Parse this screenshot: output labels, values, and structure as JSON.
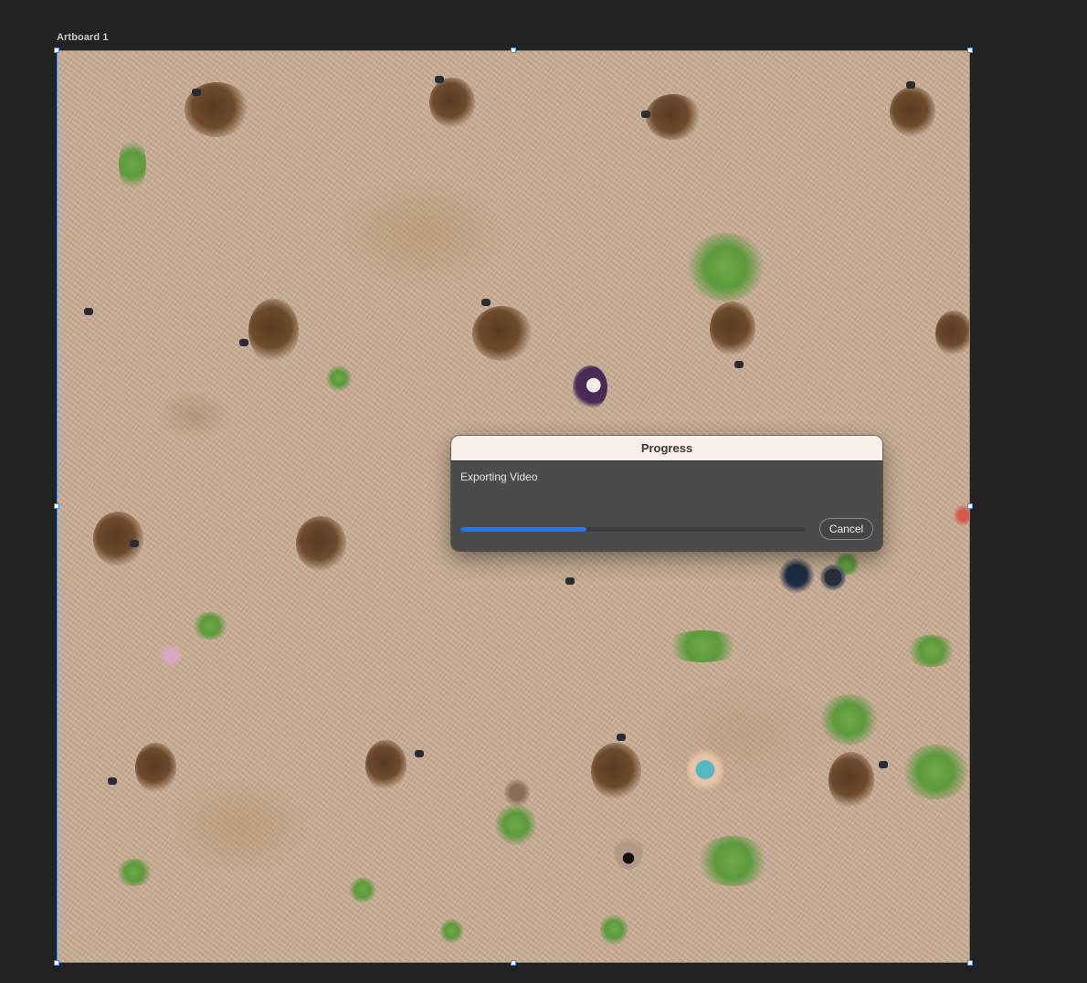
{
  "artboard": {
    "label": "Artboard 1"
  },
  "dialog": {
    "title": "Progress",
    "message": "Exporting Video",
    "progress": 0.365,
    "cancel_label": "Cancel",
    "accent_color": "#1a78f2"
  }
}
